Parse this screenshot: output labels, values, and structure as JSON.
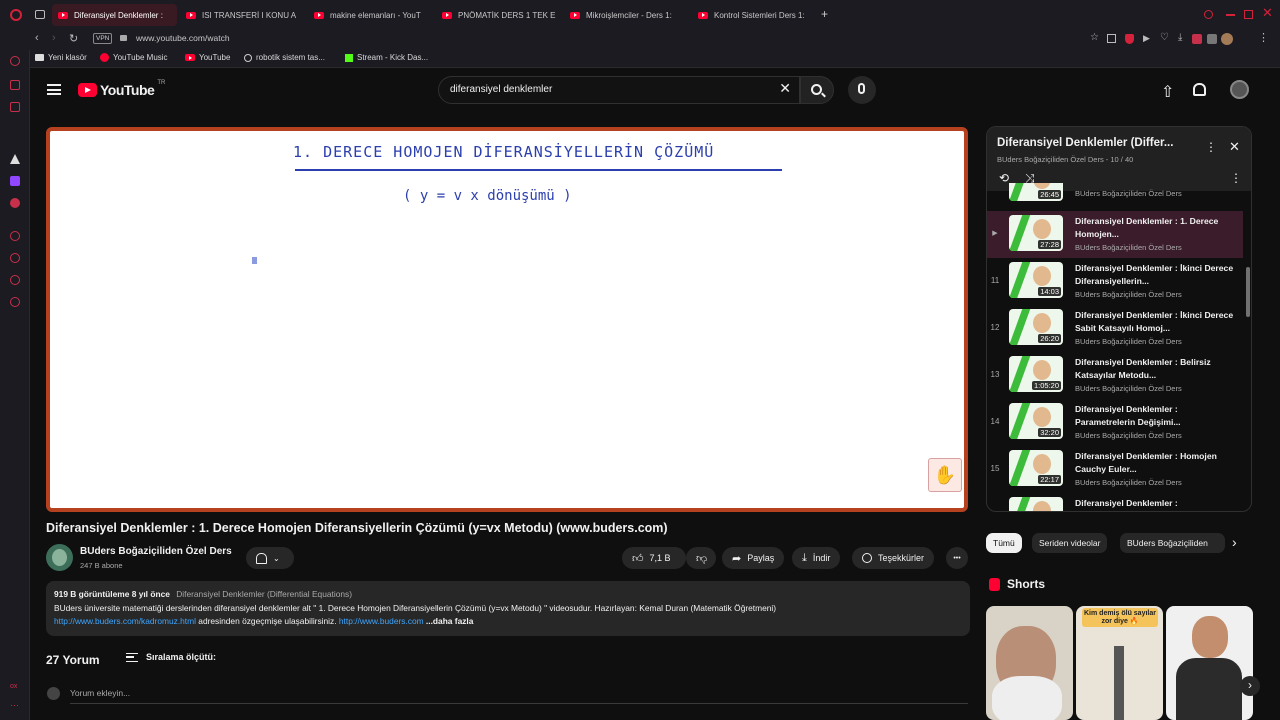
{
  "browser": {
    "tabs": [
      {
        "label": "Diferansiyel Denklemler :",
        "active": true
      },
      {
        "label": "ISI TRANSFERİ I KONU A",
        "active": false
      },
      {
        "label": "makine elemanları - YouT",
        "active": false
      },
      {
        "label": "PNÖMATİK DERS 1 TEK E",
        "active": false
      },
      {
        "label": "Mikroişlemciler - Ders 1: ",
        "active": false
      },
      {
        "label": "Kontrol Sistemleri Ders 1:",
        "active": false
      }
    ],
    "new_tab": "+",
    "vpn_badge": "VPN",
    "url": "www.youtube.com/watch",
    "bookmarks": [
      "Yeni klasör",
      "YouTube Music",
      "YouTube",
      "robotik sistem tas...",
      "Stream - Kick Das..."
    ]
  },
  "youtube": {
    "logo": "YouTube",
    "logo_region": "TR",
    "search_value": "diferansiyel denklemler",
    "video": {
      "board_title": "1. DERECE  HOMOJEN  DİFERANSİYELLERİN  ÇÖZÜMÜ",
      "board_subtitle": "( y = v x   dönüşümü )",
      "title": "Diferansiyel Denklemler : 1. Derece Homojen Diferansiyellerin Çözümü (y=vx Metodu) (www.buders.com)",
      "channel": "BUders Boğaziçiliden Özel Ders",
      "subscribers": "247 B abone",
      "likes": "7,1 B",
      "share": "Paylaş",
      "download": "İndir",
      "thanks": "Teşekkürler",
      "more": "•••"
    },
    "description": {
      "meta": "919 B görüntüleme  8 yıl önce",
      "playlist_link": "Diferansiyel Denklemler (Differential Equations)",
      "line1": "BUders üniversite matematiği derslerinden diferansiyel denklemler  alt \"  1. Derece Homojen Diferansiyellerin Çözümü (y=vx Metodu) \" videosudur. Hazırlayan: Kemal Duran (Matematik Öğretmeni)",
      "link1": "http://www.buders.com/kadromuz.html",
      "mid": " adresinden özgeçmişe ulaşabilirsiniz. ",
      "link2": "http://www.buders.com",
      "more": " ...daha fazla"
    },
    "comments": {
      "count": "27 Yorum",
      "sort": "Sıralama ölçütü:",
      "placeholder": "Yorum ekleyin..."
    },
    "playlist": {
      "title": "Diferansiyel Denklemler (Differ...",
      "channel_progress": "BUders Boğaziçiliden Özel Ders - 10 / 40",
      "partial_top_duration": "26:45",
      "partial_top_channel": "BUders Boğaziçiliden Özel Ders",
      "items": [
        {
          "idx": "▶",
          "title": "Diferansiyel Denklemler : 1. Derece Homojen...",
          "duration": "27:28",
          "channel": "BUders Boğaziçiliden Özel Ders",
          "current": true
        },
        {
          "idx": "11",
          "title": "Diferansiyel Denklemler : İkinci Derece Diferansiyellerin...",
          "duration": "14:03",
          "channel": "BUders Boğaziçiliden Özel Ders"
        },
        {
          "idx": "12",
          "title": "Diferansiyel Denklemler : İkinci Derece Sabit Katsayılı Homoj...",
          "duration": "26:20",
          "channel": "BUders Boğaziçiliden Özel Ders"
        },
        {
          "idx": "13",
          "title": "Diferansiyel Denklemler : Belirsiz Katsayılar Metodu...",
          "duration": "1:05:20",
          "channel": "BUders Boğaziçiliden Özel Ders"
        },
        {
          "idx": "14",
          "title": "Diferansiyel Denklemler : Parametrelerin Değişimi...",
          "duration": "32:20",
          "channel": "BUders Boğaziçiliden Özel Ders"
        },
        {
          "idx": "15",
          "title": "Diferansiyel Denklemler : Homojen Cauchy Euler...",
          "duration": "22:17",
          "channel": "BUders Boğaziçiliden Özel Ders"
        }
      ],
      "partial_bottom_title": "Diferansiyel Denklemler :"
    },
    "chips": [
      "Tümü",
      "Seriden videolar",
      "BUders Boğaziçiliden"
    ],
    "shorts_label": "Shorts",
    "short_caption": "Kim demiş ölü sayılar zor diye 🔥"
  }
}
